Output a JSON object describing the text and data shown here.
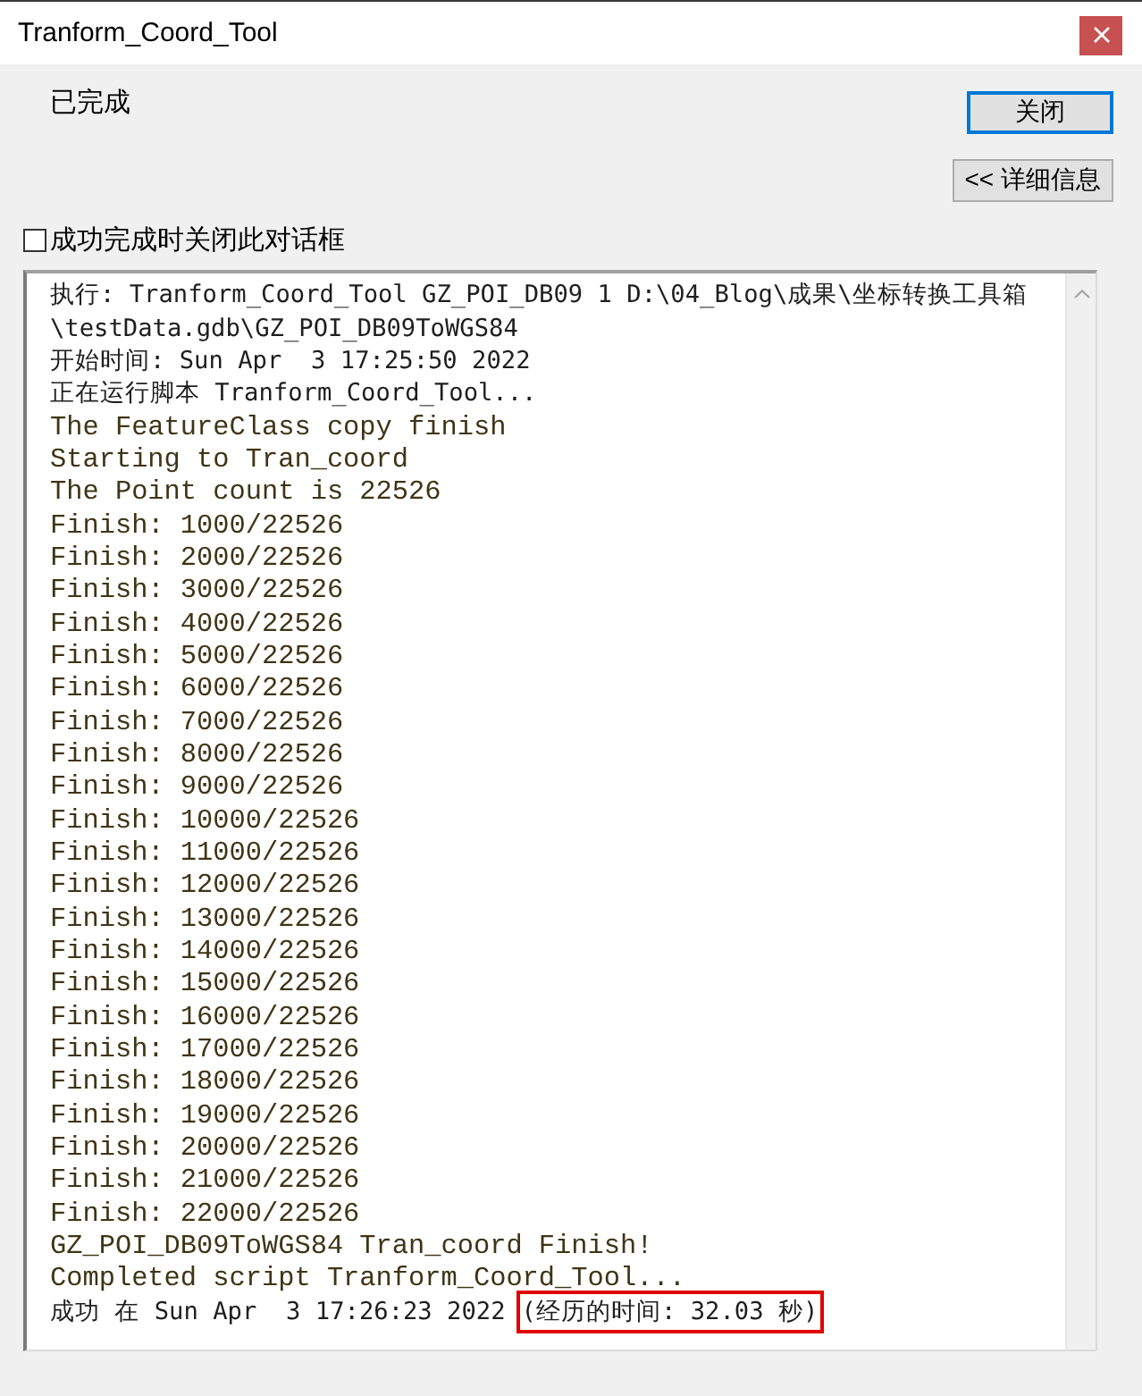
{
  "window": {
    "title": "Tranform_Coord_Tool"
  },
  "status": "已完成",
  "buttons": [
    {
      "label": "关闭",
      "default": true
    },
    {
      "label": "<< 详细信息",
      "default": false
    }
  ],
  "close_on_success": {
    "label": "成功完成时关闭此对话框",
    "checked": false
  },
  "log": {
    "lines": [
      {
        "kind": "system",
        "text": "执行: Tranform_Coord_Tool GZ_POI_DB09 1 D:\\04_Blog\\成果\\坐标转换工具箱"
      },
      {
        "kind": "system",
        "text": "\\testData.gdb\\GZ_POI_DB09ToWGS84"
      },
      {
        "kind": "system",
        "text": "开始时间: Sun Apr  3 17:25:50 2022"
      },
      {
        "kind": "system",
        "text": "正在运行脚本 Tranform_Coord_Tool..."
      },
      {
        "kind": "script",
        "text": "The FeatureClass copy finish"
      },
      {
        "kind": "script",
        "text": "Starting to Tran_coord"
      },
      {
        "kind": "script",
        "text": "The Point count is 22526"
      },
      {
        "kind": "script",
        "text": "Finish: 1000/22526"
      },
      {
        "kind": "script",
        "text": "Finish: 2000/22526"
      },
      {
        "kind": "script",
        "text": "Finish: 3000/22526"
      },
      {
        "kind": "script",
        "text": "Finish: 4000/22526"
      },
      {
        "kind": "script",
        "text": "Finish: 5000/22526"
      },
      {
        "kind": "script",
        "text": "Finish: 6000/22526"
      },
      {
        "kind": "script",
        "text": "Finish: 7000/22526"
      },
      {
        "kind": "script",
        "text": "Finish: 8000/22526"
      },
      {
        "kind": "script",
        "text": "Finish: 9000/22526"
      },
      {
        "kind": "script",
        "text": "Finish: 10000/22526"
      },
      {
        "kind": "script",
        "text": "Finish: 11000/22526"
      },
      {
        "kind": "script",
        "text": "Finish: 12000/22526"
      },
      {
        "kind": "script",
        "text": "Finish: 13000/22526"
      },
      {
        "kind": "script",
        "text": "Finish: 14000/22526"
      },
      {
        "kind": "script",
        "text": "Finish: 15000/22526"
      },
      {
        "kind": "script",
        "text": "Finish: 16000/22526"
      },
      {
        "kind": "script",
        "text": "Finish: 17000/22526"
      },
      {
        "kind": "script",
        "text": "Finish: 18000/22526"
      },
      {
        "kind": "script",
        "text": "Finish: 19000/22526"
      },
      {
        "kind": "script",
        "text": "Finish: 20000/22526"
      },
      {
        "kind": "script",
        "text": "Finish: 21000/22526"
      },
      {
        "kind": "script",
        "text": "Finish: 22000/22526"
      },
      {
        "kind": "script",
        "text": "GZ_POI_DB09ToWGS84 Tran_coord Finish!"
      },
      {
        "kind": "script",
        "text": "Completed script Tranform_Coord_Tool..."
      },
      {
        "kind": "system",
        "text": "成功 在 Sun Apr  3 17:26:23 2022",
        "highlight": "(经历的时间: 32.03 秒)"
      }
    ]
  }
}
